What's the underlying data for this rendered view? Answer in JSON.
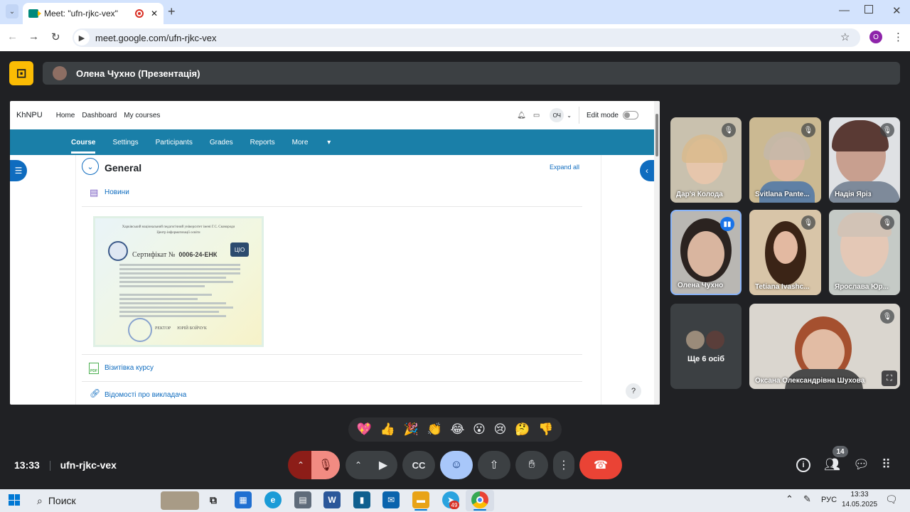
{
  "browser": {
    "tab_title": "Meet: \"ufn-rjkc-vex\"",
    "url": "meet.google.com/ufn-rjkc-vex",
    "profile_initial": "O"
  },
  "presenter_bar": {
    "label": "Олена Чухно (Презентація)"
  },
  "moodle": {
    "brand": "KhNPU",
    "top_links": [
      "Home",
      "Dashboard",
      "My courses"
    ],
    "user_initials": "ОЧ",
    "edit_mode": "Edit mode",
    "tabs": [
      "Course",
      "Settings",
      "Participants",
      "Grades",
      "Reports",
      "More"
    ],
    "section_title": "General",
    "expand_all": "Expand all",
    "forum_link": "Новини",
    "cert_number": "0006-24-ЕНК",
    "cert_title": "Сертифікат №",
    "cert_header": "Харківський національний педагогічний університет імені Г.С. Сковороди",
    "cert_subheader": "Центр інформатизації освіти",
    "cert_signer": "ЮРІЙ БОЙЧУК",
    "cert_role": "РЕКТОР",
    "cert_logo": "ЦІО",
    "pdf_badge": "PDF",
    "file_link": "Візитівка курсу",
    "teacher_link": "Відомості про викладача",
    "help": "?"
  },
  "participants": [
    {
      "name": "Дар'я Колода",
      "muted": true
    },
    {
      "name": "Svitlana Pante...",
      "muted": true
    },
    {
      "name": "Надія Яріз",
      "muted": true
    },
    {
      "name": "Олена Чухно",
      "muted": false,
      "speaking": true
    },
    {
      "name": "Tetiana Ivashc...",
      "muted": true
    },
    {
      "name": "Ярослава Юр...",
      "muted": true
    },
    {
      "name": "Ще 6 осіб",
      "more": true
    },
    {
      "name": "Оксана Олександрівна Шухова",
      "muted": true
    }
  ],
  "reactions": [
    "💖",
    "👍",
    "🎉",
    "👏",
    "😂",
    "😮",
    "😢",
    "🤔",
    "👎"
  ],
  "meeting": {
    "time": "13:33",
    "code": "ufn-rjkc-vex",
    "people_count": "14"
  },
  "taskbar": {
    "search": "Поиск",
    "lang": "РУС",
    "clock_time": "13:33",
    "clock_date": "14.05.2025",
    "telegram_badge": "49"
  },
  "colors": {
    "moodle_nav": "#1a7fa8",
    "end_call": "#ea4335",
    "muted_mic": "#f28b82",
    "emoji_active": "#a8c7fa",
    "meet_logo": "#fbbc04"
  }
}
